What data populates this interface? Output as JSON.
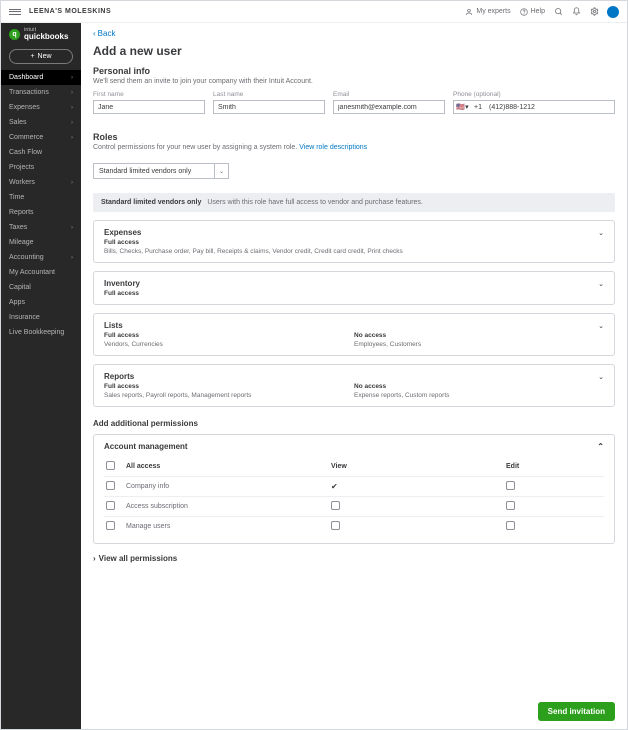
{
  "topbar": {
    "company": "LEENA'S MOLESKINS",
    "my_experts": "My experts",
    "help": "Help"
  },
  "logo": {
    "brand_small": "intuit",
    "brand": "quickbooks",
    "new_label": "New"
  },
  "sidebar": {
    "items": [
      {
        "label": "Dashboard",
        "caret": true,
        "active": true
      },
      {
        "label": "Transactions",
        "caret": true
      },
      {
        "label": "Expenses",
        "caret": true
      },
      {
        "label": "Sales",
        "caret": true
      },
      {
        "label": "Commerce",
        "caret": true
      },
      {
        "label": "Cash Flow"
      },
      {
        "label": "Projects"
      },
      {
        "label": "Workers",
        "caret": true
      },
      {
        "label": "Time"
      },
      {
        "label": "Reports"
      },
      {
        "label": "Taxes",
        "caret": true
      },
      {
        "label": "Mileage"
      },
      {
        "label": "Accounting",
        "caret": true
      },
      {
        "label": "My Accountant"
      },
      {
        "label": "Capital"
      },
      {
        "label": "Apps"
      },
      {
        "label": "Insurance"
      },
      {
        "label": "Live Bookkeeping"
      }
    ]
  },
  "page": {
    "back": "Back",
    "title": "Add a new user",
    "personal": {
      "heading": "Personal info",
      "sub": "We'll send them an invite to join your company with their Intuit Account.",
      "first_label": "First name",
      "first_value": "Jane",
      "last_label": "Last name",
      "last_value": "Smith",
      "email_label": "Email",
      "email_value": "janesmith@example.com",
      "phone_label": "Phone (optional)",
      "phone_prefix": "+1",
      "phone_value": "(412)888-1212"
    },
    "roles": {
      "heading": "Roles",
      "sub": "Control permissions for your new user by assigning a system role.",
      "link": "View role descriptions",
      "selected": "Standard limited vendors only",
      "banner_title": "Standard limited vendors only",
      "banner_desc": "Users with this role have full access to vendor and purchase features."
    },
    "panels": {
      "expenses": {
        "title": "Expenses",
        "access": "Full access",
        "desc": "Bills, Checks, Purchase order, Pay bill, Receipts & claims, Vendor credit, Credit card credit, Print checks"
      },
      "inventory": {
        "title": "Inventory",
        "access": "Full access"
      },
      "lists": {
        "title": "Lists",
        "left_access": "Full access",
        "left_desc": "Vendors, Currencies",
        "right_access": "No access",
        "right_desc": "Employees, Customers"
      },
      "reports": {
        "title": "Reports",
        "left_access": "Full access",
        "left_desc": "Sales reports, Payroll reports, Management reports",
        "right_access": "No access",
        "right_desc": "Expense reports, Custom reports"
      }
    },
    "permissions": {
      "heading": "Add additional permissions",
      "group_title": "Account management",
      "cols": {
        "all": "All access",
        "view": "View",
        "edit": "Edit"
      },
      "rows": [
        {
          "label": "Company info",
          "view_checked": true
        },
        {
          "label": "Access subscription"
        },
        {
          "label": "Manage users"
        }
      ],
      "view_all": "View all permissions"
    },
    "send_button": "Send invitation"
  }
}
